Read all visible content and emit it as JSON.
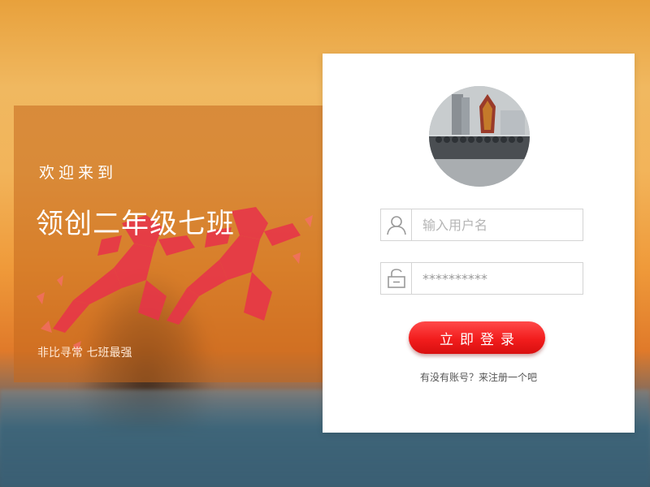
{
  "welcome": {
    "greeting": "欢迎来到",
    "title": "领创二年级七班",
    "slogan": "非比寻常  七班最强"
  },
  "login": {
    "avatar_icon": "class-group-photo",
    "username_icon": "user-icon",
    "username_placeholder": "输入用户名",
    "password_icon": "lock-icon",
    "password_value": "**********",
    "submit_label": "立即登录",
    "register_text": "有没有账号？来注册一个吧"
  },
  "colors": {
    "accent": "#f21d1d",
    "panel": "#c4681e"
  }
}
